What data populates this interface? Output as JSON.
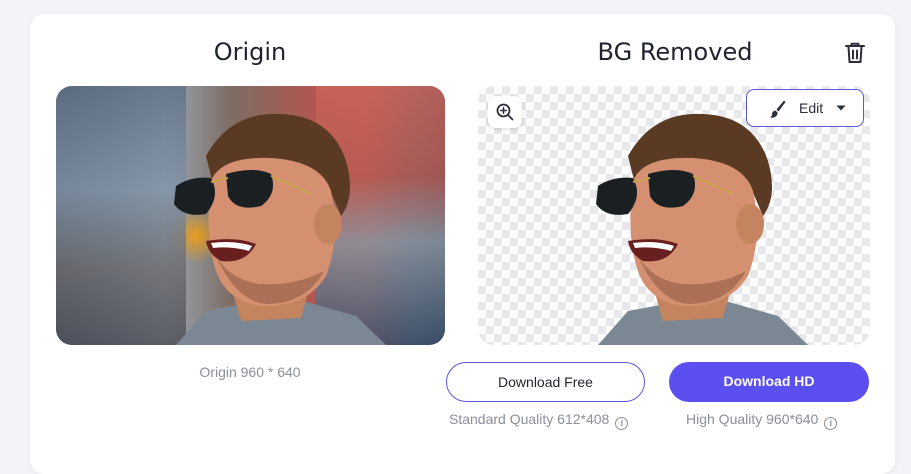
{
  "titles": {
    "origin": "Origin",
    "removed": "BG Removed"
  },
  "icons": {
    "delete": "trash-icon",
    "zoom": "zoom-in-icon",
    "edit": "brush-icon",
    "caret": "caret-down-icon",
    "info": "info-icon"
  },
  "edit": {
    "label": "Edit"
  },
  "origin_dimensions": "Origin 960 * 640",
  "buttons": {
    "download_free": "Download Free",
    "download_hd": "Download HD"
  },
  "quality": {
    "standard": "Standard Quality 612*408",
    "high": "High Quality 960*640",
    "info_glyph": "i"
  },
  "colors": {
    "accent": "#5b4ff0",
    "border_accent": "#5b56d9",
    "muted_text": "#8a8f9c"
  }
}
